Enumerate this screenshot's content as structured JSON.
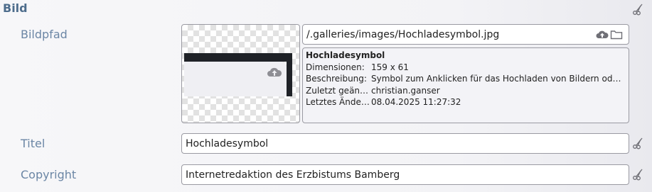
{
  "section": {
    "title": "Bild"
  },
  "fields": {
    "bildpfad": {
      "label": "Bildpfad",
      "value": "/.galleries/images/Hochladesymbol.jpg",
      "upload_icon": "cloud-upload-icon",
      "folder_icon": "folder-icon"
    },
    "titel": {
      "label": "Titel",
      "value": "Hochladesymbol"
    },
    "copyright": {
      "label": "Copyright",
      "value": "Internetredaktion des Erzbistums Bamberg"
    }
  },
  "info": {
    "name": "Hochladesymbol",
    "rows": [
      {
        "key": "Dimensionen:",
        "value": "159 x 61"
      },
      {
        "key": "Beschreibung:",
        "value": "Symbol zum Anklicken für das Hochladen von Bildern oder Do..."
      },
      {
        "key": "Zuletzt geänd...",
        "value": "christian.ganser"
      },
      {
        "key": "Letztes Änder...",
        "value": "08.04.2025 11:27:32"
      }
    ]
  },
  "icons": {
    "reset": "scissors-icon"
  },
  "colors": {
    "label": "#6b86a5",
    "section_title": "#4e6d8c",
    "border": "#9a9aa2"
  }
}
